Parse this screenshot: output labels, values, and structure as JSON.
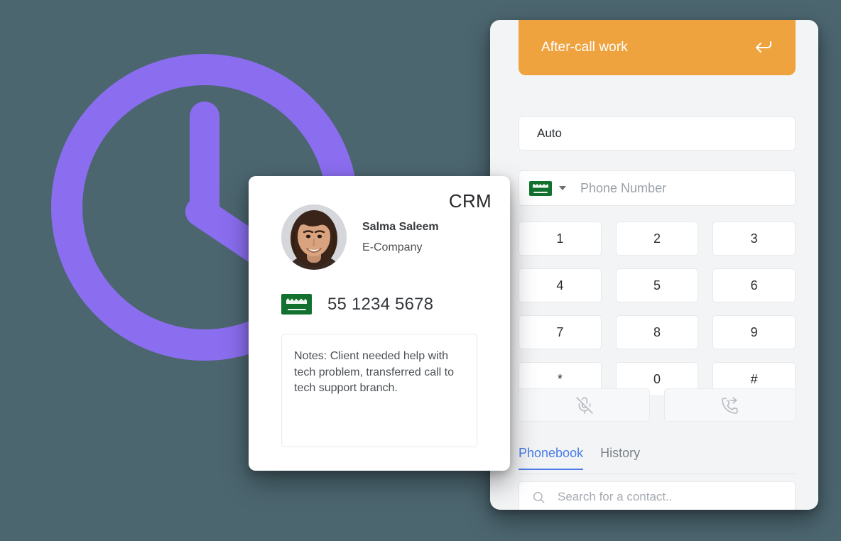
{
  "background_color": "#4c6670",
  "illustration": {
    "name": "clock",
    "color": "#8b6ef0"
  },
  "softphone": {
    "status_banner": {
      "label": "After-call work",
      "color": "#efa33f",
      "icon": "return-arrow-icon"
    },
    "status_select": {
      "value": "Auto"
    },
    "phone_input": {
      "country_flag": "saudi-arabia-flag",
      "placeholder": "Phone Number",
      "value": ""
    },
    "keypad": [
      "1",
      "2",
      "3",
      "4",
      "5",
      "6",
      "7",
      "8",
      "9",
      "*",
      "0",
      "#"
    ],
    "call_actions": [
      {
        "name": "mute-button",
        "icon": "microphone-muted-icon"
      },
      {
        "name": "transfer-call-button",
        "icon": "phone-transfer-icon"
      }
    ],
    "tabs": [
      {
        "label": "Phonebook",
        "active": true
      },
      {
        "label": "History",
        "active": false
      }
    ],
    "tabs_active_color": "#4a7ce8",
    "search": {
      "placeholder": "Search for a contact..",
      "value": "",
      "icon": "search-icon"
    }
  },
  "crm_card": {
    "title": "CRM",
    "avatar": "contact-photo",
    "contact_name": "Salma Saleem",
    "contact_company": "E-Company",
    "phone_flag": "saudi-arabia-flag",
    "phone_number": "55 1234 5678",
    "notes": "Notes: Client needed help with tech problem, transferred call to tech support branch."
  }
}
